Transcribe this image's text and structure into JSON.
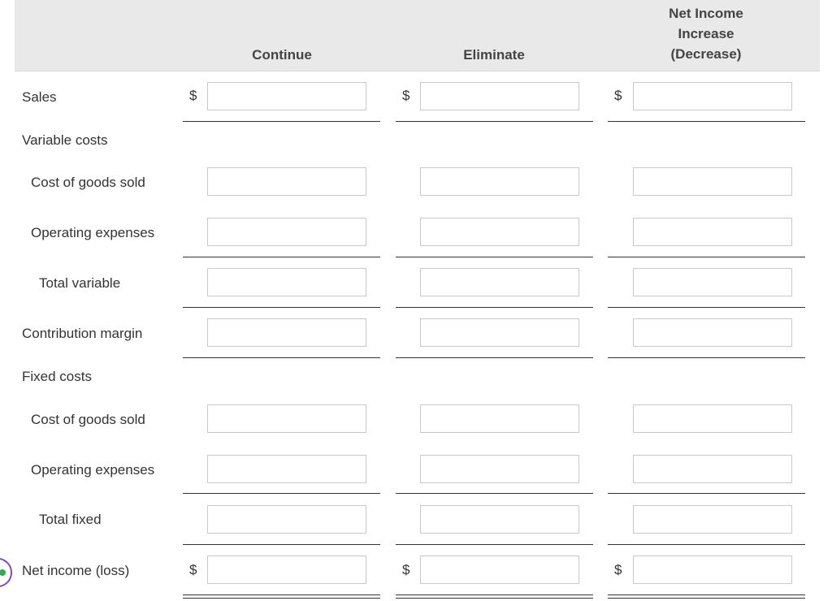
{
  "headers": {
    "continue": "Continue",
    "eliminate": "Eliminate",
    "net_line1": "Net Income",
    "net_line2": "Increase",
    "net_line3": "(Decrease)"
  },
  "rows": {
    "sales": "Sales",
    "variable_costs": "Variable costs",
    "var_cogs": "Cost of goods sold",
    "var_opex": "Operating expenses",
    "total_variable": "Total variable",
    "contribution_margin": "Contribution margin",
    "fixed_costs": "Fixed costs",
    "fixed_cogs": "Cost of goods sold",
    "fixed_opex": "Operating expenses",
    "total_fixed": "Total fixed",
    "net_income": "Net income (loss)"
  },
  "currency_symbol": "$",
  "inputs": {
    "sales": [
      "",
      "",
      ""
    ],
    "var_cogs": [
      "",
      "",
      ""
    ],
    "var_opex": [
      "",
      "",
      ""
    ],
    "total_variable": [
      "",
      "",
      ""
    ],
    "contribution_margin": [
      "",
      "",
      ""
    ],
    "fixed_cogs": [
      "",
      "",
      ""
    ],
    "fixed_opex": [
      "",
      "",
      ""
    ],
    "total_fixed": [
      "",
      "",
      ""
    ],
    "net_income": [
      "",
      "",
      ""
    ]
  }
}
